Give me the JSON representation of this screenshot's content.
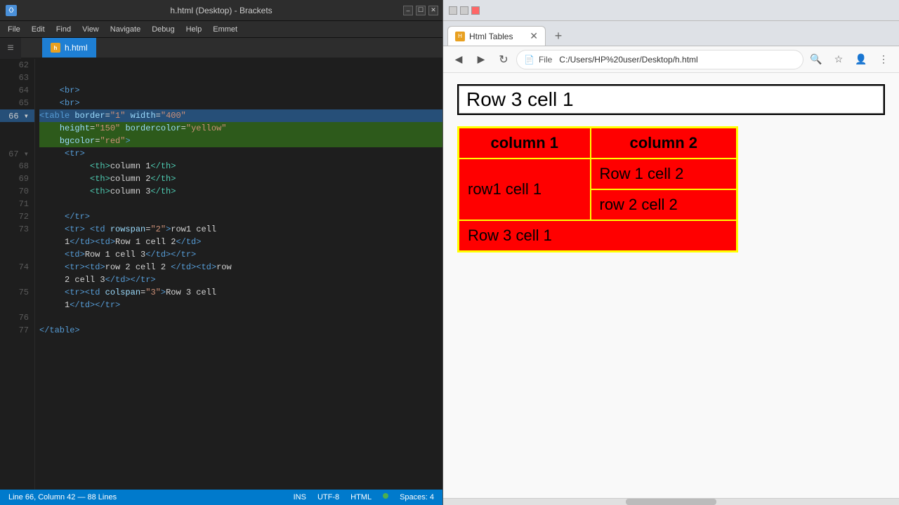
{
  "editor": {
    "title": "h.html (Desktop) - Brackets",
    "tab_label": "h.html",
    "lines": [
      {
        "num": "62",
        "content": "",
        "tokens": []
      },
      {
        "num": "63",
        "content": "",
        "tokens": []
      },
      {
        "num": "64",
        "content": "    <br>",
        "tokens": [
          {
            "type": "c-tag",
            "text": "    <br>"
          }
        ]
      },
      {
        "num": "65",
        "content": "    <br>",
        "tokens": [
          {
            "type": "c-tag",
            "text": "    <br>"
          }
        ]
      },
      {
        "num": "66",
        "content": "<table border=\"1\" width=\"400\"",
        "highlight": "selected",
        "tokens": [
          {
            "type": "c-tag",
            "text": "<table "
          },
          {
            "type": "c-attr",
            "text": "border"
          },
          {
            "type": "c-bracket",
            "text": "="
          },
          {
            "type": "c-val",
            "text": "\"1\""
          },
          {
            "type": "c-bracket",
            "text": " "
          },
          {
            "type": "c-attr",
            "text": "width"
          },
          {
            "type": "c-bracket",
            "text": "="
          },
          {
            "type": "c-val",
            "text": "\"400\""
          }
        ]
      },
      {
        "num": "",
        "content": "    height=\"150\" bordercolor=\"yellow\"",
        "highlight": "selected",
        "tokens": [
          {
            "type": "c-bracket",
            "text": "    "
          },
          {
            "type": "c-attr",
            "text": "height"
          },
          {
            "type": "c-bracket",
            "text": "="
          },
          {
            "type": "c-val",
            "text": "\"150\""
          },
          {
            "type": "c-bracket",
            "text": " "
          },
          {
            "type": "c-attr",
            "text": "bordercolor"
          },
          {
            "type": "c-bracket",
            "text": "="
          },
          {
            "type": "c-val",
            "text": "\"yellow\""
          }
        ]
      },
      {
        "num": "",
        "content": "    bgcolor=\"red\">",
        "highlight": "selected",
        "tokens": [
          {
            "type": "c-bracket",
            "text": "    "
          },
          {
            "type": "c-attr",
            "text": "bgcolor"
          },
          {
            "type": "c-bracket",
            "text": "="
          },
          {
            "type": "c-val",
            "text": "\"red\""
          },
          {
            "type": "c-tag",
            "text": ">"
          }
        ]
      },
      {
        "num": "67",
        "content": "     <tr>",
        "tokens": [
          {
            "type": "c-tag",
            "text": "     <tr>"
          }
        ]
      },
      {
        "num": "68",
        "content": "          <th>column 1</th>",
        "tokens": [
          {
            "type": "c-bracket",
            "text": "          "
          },
          {
            "type": "c-th",
            "text": "<th>"
          },
          {
            "type": "c-text",
            "text": "column 1"
          },
          {
            "type": "c-th",
            "text": "</th>"
          }
        ]
      },
      {
        "num": "69",
        "content": "          <th>column 2</th>",
        "tokens": [
          {
            "type": "c-bracket",
            "text": "          "
          },
          {
            "type": "c-th",
            "text": "<th>"
          },
          {
            "type": "c-text",
            "text": "column 2"
          },
          {
            "type": "c-th",
            "text": "</th>"
          }
        ]
      },
      {
        "num": "70",
        "content": "          <th>column 3</th>",
        "tokens": [
          {
            "type": "c-bracket",
            "text": "          "
          },
          {
            "type": "c-th",
            "text": "<th>"
          },
          {
            "type": "c-text",
            "text": "column 3"
          },
          {
            "type": "c-th",
            "text": "</th>"
          }
        ]
      },
      {
        "num": "71",
        "content": "",
        "tokens": []
      },
      {
        "num": "72",
        "content": "     </tr>",
        "tokens": [
          {
            "type": "c-tag",
            "text": "     </tr>"
          }
        ]
      },
      {
        "num": "73",
        "content": "     <tr> <td rowspan=\"2\">row1 cell",
        "tokens": [
          {
            "type": "c-tag",
            "text": "     <tr> "
          },
          {
            "type": "c-tag",
            "text": "<td "
          },
          {
            "type": "c-attr",
            "text": "rowspan"
          },
          {
            "type": "c-bracket",
            "text": "="
          },
          {
            "type": "c-val",
            "text": "\"2\""
          },
          {
            "type": "c-tag",
            "text": ">"
          },
          {
            "type": "c-text",
            "text": "row1 cell"
          }
        ]
      },
      {
        "num": "",
        "content": "     1</td><td>Row 1 cell 2</td>",
        "tokens": [
          {
            "type": "c-text",
            "text": "     1"
          },
          {
            "type": "c-tag",
            "text": "</td>"
          },
          {
            "type": "c-tag",
            "text": "<td>"
          },
          {
            "type": "c-text",
            "text": "Row 1 cell 2"
          },
          {
            "type": "c-tag",
            "text": "</td>"
          }
        ]
      },
      {
        "num": "",
        "content": "     <td>Row 1 cell 3</td></tr>",
        "tokens": [
          {
            "type": "c-tag",
            "text": "     "
          },
          {
            "type": "c-tag",
            "text": "<td>"
          },
          {
            "type": "c-text",
            "text": "Row 1 cell 3"
          },
          {
            "type": "c-tag",
            "text": "</td></tr>"
          }
        ]
      },
      {
        "num": "74",
        "content": "     <tr><td>row 2 cell 2 </td><td>row",
        "tokens": [
          {
            "type": "c-tag",
            "text": "     <tr>"
          },
          {
            "type": "c-tag",
            "text": "<td>"
          },
          {
            "type": "c-text",
            "text": "row 2 cell 2 "
          },
          {
            "type": "c-tag",
            "text": "</td>"
          },
          {
            "type": "c-tag",
            "text": "<td>"
          },
          {
            "type": "c-text",
            "text": "row"
          }
        ]
      },
      {
        "num": "",
        "content": "     2 cell 3</td></tr>",
        "tokens": [
          {
            "type": "c-text",
            "text": "     2 cell 3"
          },
          {
            "type": "c-tag",
            "text": "</td></tr>"
          }
        ]
      },
      {
        "num": "75",
        "content": "     <tr><td colspan=\"3\">Row 3 cell",
        "tokens": [
          {
            "type": "c-tag",
            "text": "     <tr>"
          },
          {
            "type": "c-tag",
            "text": "<td "
          },
          {
            "type": "c-attr",
            "text": "colspan"
          },
          {
            "type": "c-bracket",
            "text": "="
          },
          {
            "type": "c-val",
            "text": "\"3\""
          },
          {
            "type": "c-tag",
            "text": ">"
          },
          {
            "type": "c-text",
            "text": "Row 3 cell"
          }
        ]
      },
      {
        "num": "",
        "content": "     1</td></tr>",
        "tokens": [
          {
            "type": "c-text",
            "text": "     1"
          },
          {
            "type": "c-tag",
            "text": "</td></tr>"
          }
        ]
      },
      {
        "num": "76",
        "content": "",
        "tokens": []
      },
      {
        "num": "77",
        "content": "</table>",
        "tokens": [
          {
            "type": "c-tag",
            "text": "</table>"
          }
        ]
      }
    ],
    "statusbar": {
      "position": "Line 66, Column 42 — 88 Lines",
      "ins": "INS",
      "encoding": "UTF-8",
      "mode": "HTML",
      "spaces": "Spaces: 4"
    },
    "menu": [
      "File",
      "Edit",
      "Find",
      "View",
      "Navigate",
      "Debug",
      "Help",
      "Emmet"
    ]
  },
  "browser": {
    "title": "Html Tables",
    "address": "C:/Users/HP%20user/Desktop/h.html",
    "address_display": "File   C:/Users/HP%20user/Desktop/h.html",
    "table": {
      "headers": [
        "column 1",
        "column 2"
      ],
      "cells": {
        "row1_cell1": "row1 cell 1",
        "row1_cell2": "Row 1 cell 2",
        "row2_cell2": "row 2 cell 2",
        "row3": "Row 3 cell 1",
        "prev_row3": "Row 3 cell 1"
      }
    },
    "new_tab_label": "+",
    "back_icon": "◀",
    "forward_icon": "▶",
    "reload_icon": "↻",
    "zoom_icon": "🔍",
    "bookmark_icon": "☆",
    "profile_icon": "👤",
    "menu_icon": "⋮"
  }
}
